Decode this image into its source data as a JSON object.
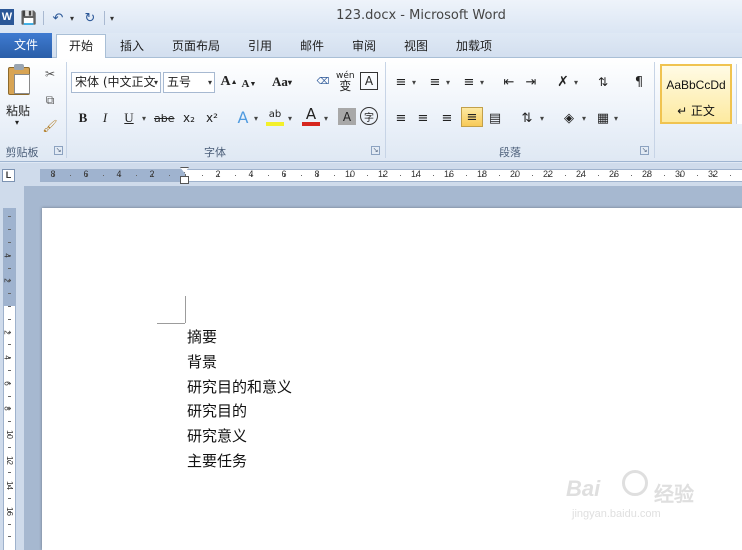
{
  "app": {
    "icon_letter": "W",
    "window_title": "123.docx - Microsoft Word",
    "accent_color": "#2b5797"
  },
  "quick_access": [
    "save-icon",
    "undo-icon",
    "redo-icon",
    "customize-icon"
  ],
  "tabs": {
    "file": "文件",
    "items": [
      "开始",
      "插入",
      "页面布局",
      "引用",
      "邮件",
      "审阅",
      "视图",
      "加载项"
    ],
    "active": "开始"
  },
  "ribbon": {
    "clipboard": {
      "paste_label": "粘贴",
      "group_label": "剪贴板"
    },
    "font": {
      "font_name": "宋体 (中文正文",
      "font_size": "五号",
      "grow_label": "A",
      "shrink_label": "A",
      "case_label": "Aa",
      "bold": "B",
      "italic": "I",
      "underline": "U",
      "strike": "abe",
      "subscript": "x₂",
      "superscript": "x²",
      "text_effect": "A",
      "highlight": "ab",
      "font_color": "A",
      "char_shade": "A",
      "enclose": "字",
      "phonetic": "wén",
      "phonetic_char": "变",
      "char_border": "A",
      "group_label": "字体"
    },
    "paragraph": {
      "group_label": "段落"
    },
    "styles": {
      "sample": "AaBbCcDd",
      "name": "↵ 正文"
    }
  },
  "ruler": {
    "horizontal_labels": [
      "8",
      "6",
      "4",
      "2",
      "2",
      "4",
      "6",
      "8",
      "10",
      "12",
      "14",
      "16",
      "18",
      "20",
      "22",
      "24",
      "26",
      "28",
      "30",
      "32"
    ],
    "vertical_labels": [
      "4",
      "2",
      "2",
      "4",
      "6",
      "8",
      "10",
      "12",
      "14",
      "16"
    ],
    "corner": "L"
  },
  "document": {
    "lines": [
      "摘要",
      "背景",
      "研究目的和意义",
      "研究目的",
      "研究意义",
      "主要任务"
    ]
  },
  "watermark": {
    "brand": "Bai",
    "brand_suffix": "经验",
    "url": "jingyan.baidu.com"
  }
}
